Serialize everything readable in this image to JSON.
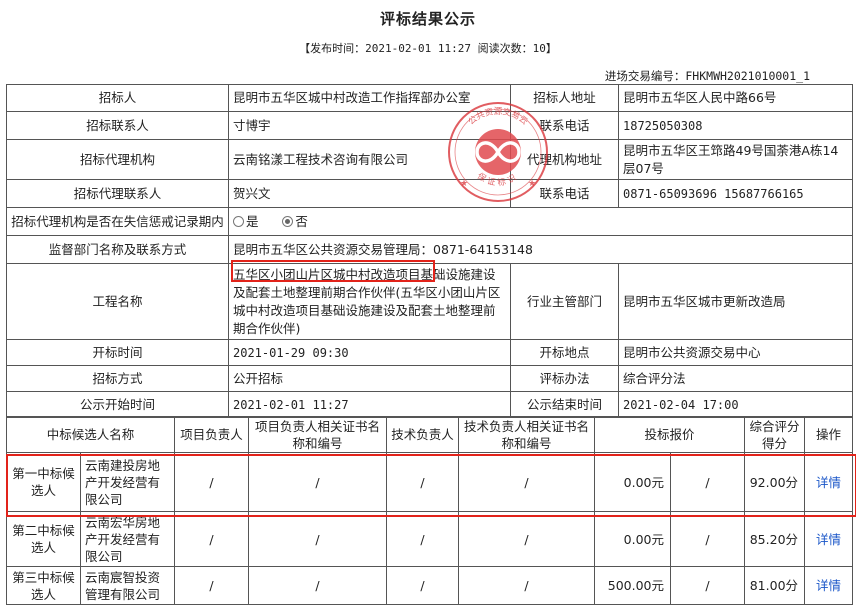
{
  "title": "评标结果公示",
  "meta": "【发布时间：2021-02-01 11:27  阅读次数：10】",
  "trade_no": "进场交易编号：FHKMWH2021010001_1",
  "info": {
    "bidder_label": "招标人",
    "bidder": "昆明市五华区城中村改造工作指挥部办公室",
    "bidder_addr_label": "招标人地址",
    "bidder_addr": "昆明市五华区人民中路66号",
    "contact_label": "招标联系人",
    "contact": "寸博宇",
    "phone_label": "联系电话",
    "phone": "18725050308",
    "agency_label": "招标代理机构",
    "agency": "云南铭漾工程技术咨询有限公司",
    "agency_addr_label": "代理机构地址",
    "agency_addr": "昆明市五华区王筇路49号国荼港A栋14层07号",
    "agency_contact_label": "招标代理联系人",
    "agency_contact": "贺兴文",
    "agency_phone_label": "联系电话",
    "agency_phone": "0871-65093696 15687766165",
    "dishonest_label": "招标代理机构是否在失信惩戒记录期内",
    "yes": "是",
    "no": "否",
    "supervisor_label": "监督部门名称及联系方式",
    "supervisor": "昆明市五华区公共资源交易管理局：0871-64153148",
    "project_label": "工程名称",
    "project_highlight": "五华区小团山片区城中村改造项目",
    "project_rest": "基础设施建设及配套土地整理前期合作伙伴(五华区小团山片区城中村改造项目基础设施建设及配套土地整理前期合作伙伴)",
    "authority_label": "行业主管部门",
    "authority": "昆明市五华区城市更新改造局",
    "open_time_label": "开标时间",
    "open_time": "2021-01-29 09:30",
    "open_place_label": "开标地点",
    "open_place": "昆明市公共资源交易中心",
    "method_label": "招标方式",
    "method": "公开招标",
    "eval_label": "评标办法",
    "eval": "综合评分法",
    "pub_start_label": "公示开始时间",
    "pub_start": "2021-02-01 11:27",
    "pub_end_label": "公示结束时间",
    "pub_end": "2021-02-04 17:00"
  },
  "stamp": {
    "ring_top": "公共资源交易云",
    "ring_bottom": "保证标识",
    "color": "#d9353a"
  },
  "candidates": {
    "headers": {
      "name": "中标候选人名称",
      "pm": "项目负责人",
      "pm_cert": "项目负责人相关证书名称和编号",
      "tech": "技术负责人",
      "tech_cert": "技术负责人相关证书名称和编号",
      "price": "投标报价",
      "score": "综合评分得分",
      "op": "操作"
    },
    "rows": [
      {
        "rank": "第一中标候选人",
        "name": "云南建投房地产开发经营有限公司",
        "pm": "/",
        "pm_cert": "/",
        "tech": "/",
        "tech_cert": "/",
        "price": "0.00元",
        "price2": "/",
        "score": "92.00分",
        "op": "详情"
      },
      {
        "rank": "第二中标候选人",
        "name": "云南宏华房地产开发经营有限公司",
        "pm": "/",
        "pm_cert": "/",
        "tech": "/",
        "tech_cert": "/",
        "price": "0.00元",
        "price2": "/",
        "score": "85.20分",
        "op": "详情"
      },
      {
        "rank": "第三中标候选人",
        "name": "云南宸智投资管理有限公司",
        "pm": "/",
        "pm_cert": "/",
        "tech": "/",
        "tech_cert": "/",
        "price": "500.00元",
        "price2": "/",
        "score": "81.00分",
        "op": "详情"
      }
    ]
  }
}
